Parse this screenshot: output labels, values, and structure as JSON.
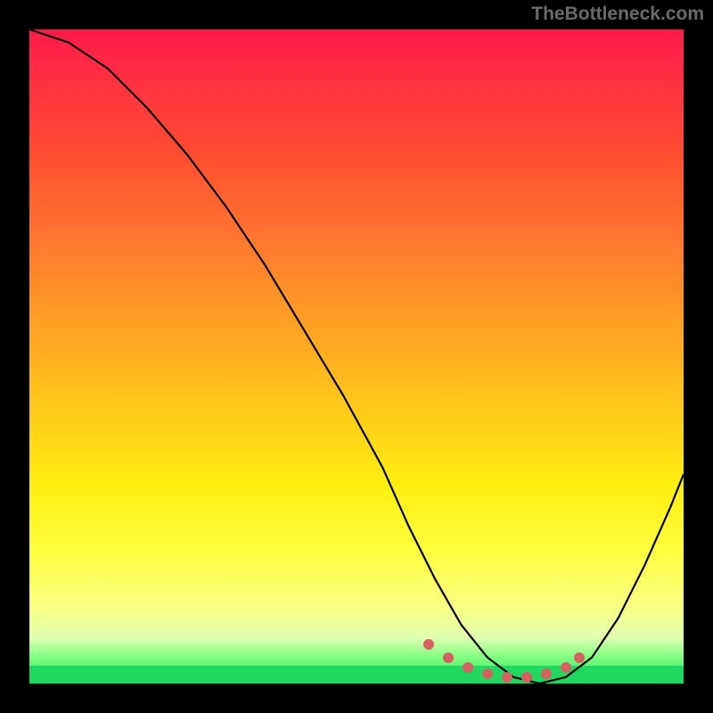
{
  "watermark": "TheBottleneck.com",
  "chart_data": {
    "type": "line",
    "title": "",
    "xlabel": "",
    "ylabel": "",
    "xlim": [
      0,
      100
    ],
    "ylim": [
      0,
      100
    ],
    "series": [
      {
        "name": "curve",
        "x": [
          0,
          6,
          12,
          18,
          24,
          30,
          36,
          42,
          48,
          54,
          58,
          62,
          66,
          70,
          74,
          78,
          82,
          86,
          90,
          94,
          98,
          100
        ],
        "values": [
          100,
          98,
          94,
          88,
          81,
          73,
          64,
          54,
          44,
          33,
          24,
          16,
          9,
          4,
          1,
          0,
          1,
          4,
          10,
          18,
          27,
          32
        ]
      }
    ],
    "highlight_dots": {
      "x": [
        61,
        64,
        67,
        70,
        73,
        76,
        79,
        82,
        84
      ],
      "values": [
        6,
        4,
        2.5,
        1.5,
        1,
        1,
        1.5,
        2.5,
        4
      ]
    },
    "gradient_stops": [
      {
        "pos": 0,
        "color": "#ff1a4a"
      },
      {
        "pos": 50,
        "color": "#ffb020"
      },
      {
        "pos": 80,
        "color": "#ffff40"
      },
      {
        "pos": 100,
        "color": "#20e060"
      }
    ]
  }
}
